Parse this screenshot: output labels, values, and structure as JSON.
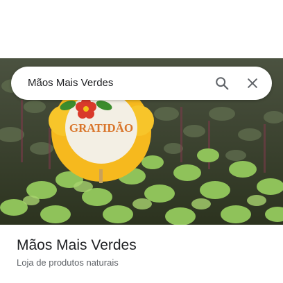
{
  "search": {
    "query": "Mãos Mais Verdes",
    "search_icon": "search-icon",
    "close_icon": "close-icon"
  },
  "photo": {
    "sign_text": "GRATIDÃO"
  },
  "place": {
    "name": "Mãos Mais Verdes",
    "category": "Loja de produtos naturais"
  },
  "colors": {
    "text_primary": "#202124",
    "text_secondary": "#5f6368",
    "icon": "#5f6368"
  }
}
